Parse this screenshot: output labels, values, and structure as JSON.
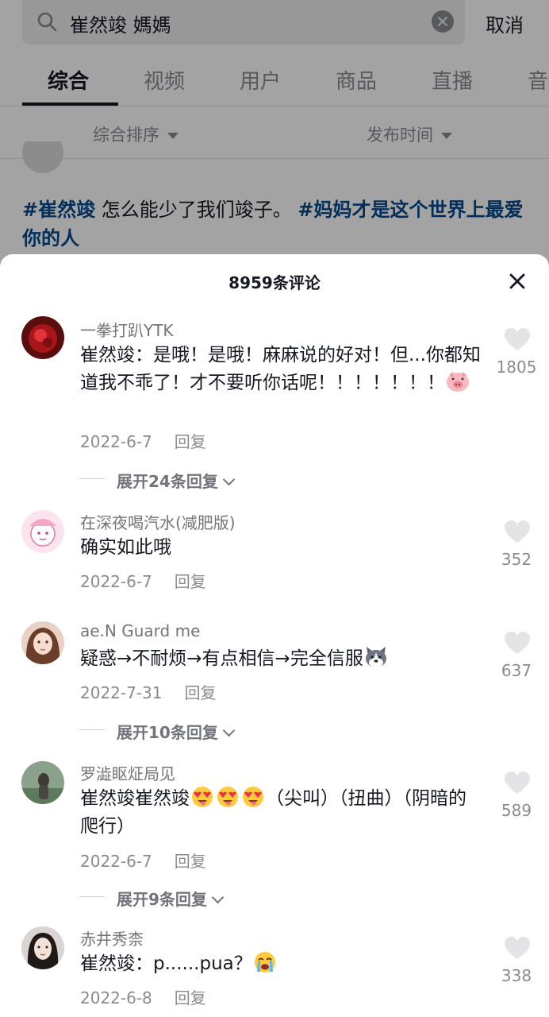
{
  "search": {
    "query": "崔然竣 媽媽",
    "cancel_label": "取消"
  },
  "tabs": [
    {
      "label": "综合",
      "active": true
    },
    {
      "label": "视频",
      "active": false
    },
    {
      "label": "用户",
      "active": false
    },
    {
      "label": "商品",
      "active": false
    },
    {
      "label": "直播",
      "active": false
    },
    {
      "label": "音",
      "active": false
    }
  ],
  "filters": {
    "sort_label": "综合排序",
    "time_label": "发布时间"
  },
  "video": {
    "caption_tag1": "#崔然竣",
    "caption_text": " 怎么能少了我们竣子。 ",
    "caption_tag2": "#妈妈才是这个世界上最爱你的人"
  },
  "comments_panel": {
    "title": "8959条评论",
    "reply_label": "回复",
    "comments": [
      {
        "username": "一拳打趴YTK",
        "text": "崔然竣：是哦！是哦！麻麻说的好对！但...你都知道我不乖了！才不要听你话呢！！！！！！！",
        "emoji": "pig-face",
        "date": "2022-6-7",
        "likes": "1805",
        "expand_label": "展开24条回复"
      },
      {
        "username": "在深夜喝汽水(减肥版)",
        "text": "确实如此哦",
        "date": "2022-6-7",
        "likes": "352"
      },
      {
        "username": "ae.N Guard me",
        "text": "疑惑→不耐烦→有点相信→完全信服",
        "emoji": "husky-face",
        "date": "2022-7-31",
        "likes": "637",
        "expand_label": "展开10条回复"
      },
      {
        "username": "罗澁眍炡局见",
        "text": "崔然竣崔然竣",
        "text_after_emoji": "（尖叫）（扭曲）（阴暗的爬行）",
        "emoji": "heart-eyes-tongue",
        "date": "2022-6-7",
        "likes": "589",
        "expand_label": "展开9条回复"
      },
      {
        "username": "赤井秀柰",
        "text": "崔然竣：p......pua？",
        "emoji": "crying-face",
        "date": "2022-6-8",
        "likes": "338"
      }
    ]
  },
  "colors": {
    "hashtag": "#04498d",
    "secondary_text": "#8a8b91",
    "primary_text": "#161823"
  }
}
